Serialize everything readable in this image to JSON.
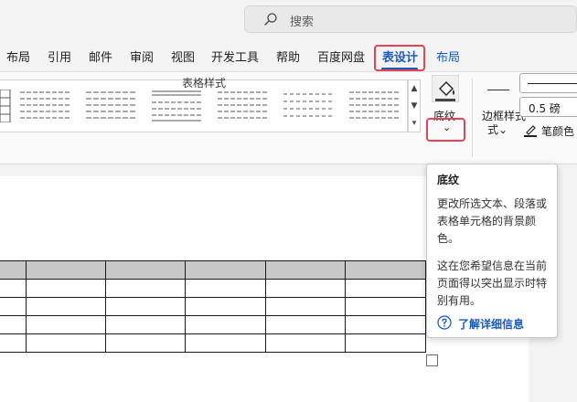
{
  "search": {
    "placeholder": "搜索"
  },
  "tabs": [
    {
      "label": "布局"
    },
    {
      "label": "引用"
    },
    {
      "label": "邮件"
    },
    {
      "label": "审阅"
    },
    {
      "label": "视图"
    },
    {
      "label": "开发工具"
    },
    {
      "label": "帮助"
    },
    {
      "label": "百度网盘"
    },
    {
      "label": "表设计"
    },
    {
      "label": "布局"
    }
  ],
  "ribbon": {
    "table_styles_label": "表格样式",
    "shading_label": "底纹",
    "border_styles_label": "边框样式",
    "border_weight": "0.5 磅",
    "pen_color_label": "笔颜色"
  },
  "tooltip": {
    "title": "底纹",
    "lines": [
      "更改所选文本、段落或",
      "表格单元格的背景颜",
      "色。",
      "这在您希望信息在当前",
      "页面得以突出显示时特",
      "别有用。"
    ],
    "link": "了解详细信息"
  },
  "colors": {
    "accent": "#185abd",
    "highlight_box": "#e0455a",
    "header_row_fill": "#c8c8c8"
  }
}
